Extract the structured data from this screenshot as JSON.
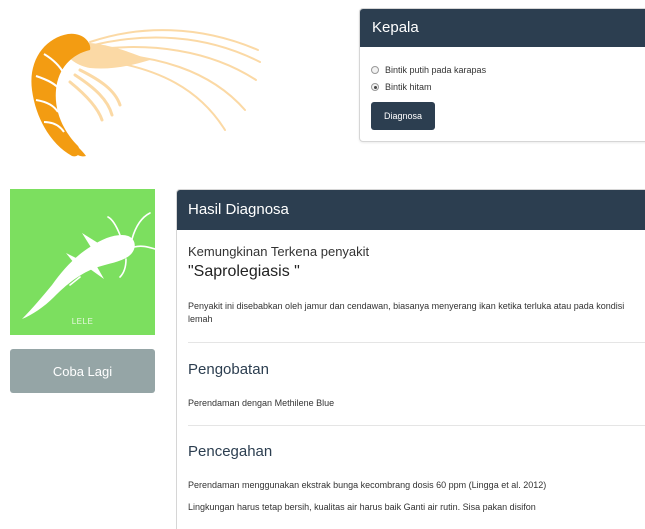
{
  "kepala": {
    "title": "Kepala",
    "options": [
      {
        "label": "Bintik putih pada karapas",
        "checked": false
      },
      {
        "label": "Bintik hitam",
        "checked": true
      }
    ],
    "submit_label": "Diagnosa"
  },
  "fish": {
    "label": "LELE"
  },
  "retry_label": "Coba Lagi",
  "hasil": {
    "title": "Hasil Diagnosa",
    "subtitle": "Kemungkinan Terkena penyakit",
    "disease": "\"Saprolegiasis \"",
    "description": "Penyakit ini disebabkan oleh jamur dan cendawan, biasanya menyerang ikan ketika terluka atau pada kondisi lemah",
    "pengobatan": {
      "title": "Pengobatan",
      "text": "Perendaman dengan Methilene Blue"
    },
    "pencegahan": {
      "title": "Pencegahan",
      "items": [
        "Perendaman menggunakan ekstrak bunga kecombrang dosis 60 ppm (Lingga et al. 2012)",
        "Lingkungan harus tetap bersih, kualitas air harus baik Ganti air rutin. Sisa pakan disifon"
      ]
    }
  },
  "colors": {
    "header_dark": "#2c3e50",
    "fish_card_green": "#7cdf5f",
    "retry_button_gray": "#95a5a6",
    "shrimp_orange": "#f39c12",
    "shrimp_light": "#fbd9a5"
  },
  "icons": {
    "shrimp": "shrimp-illustration",
    "fish": "catfish-icon"
  }
}
